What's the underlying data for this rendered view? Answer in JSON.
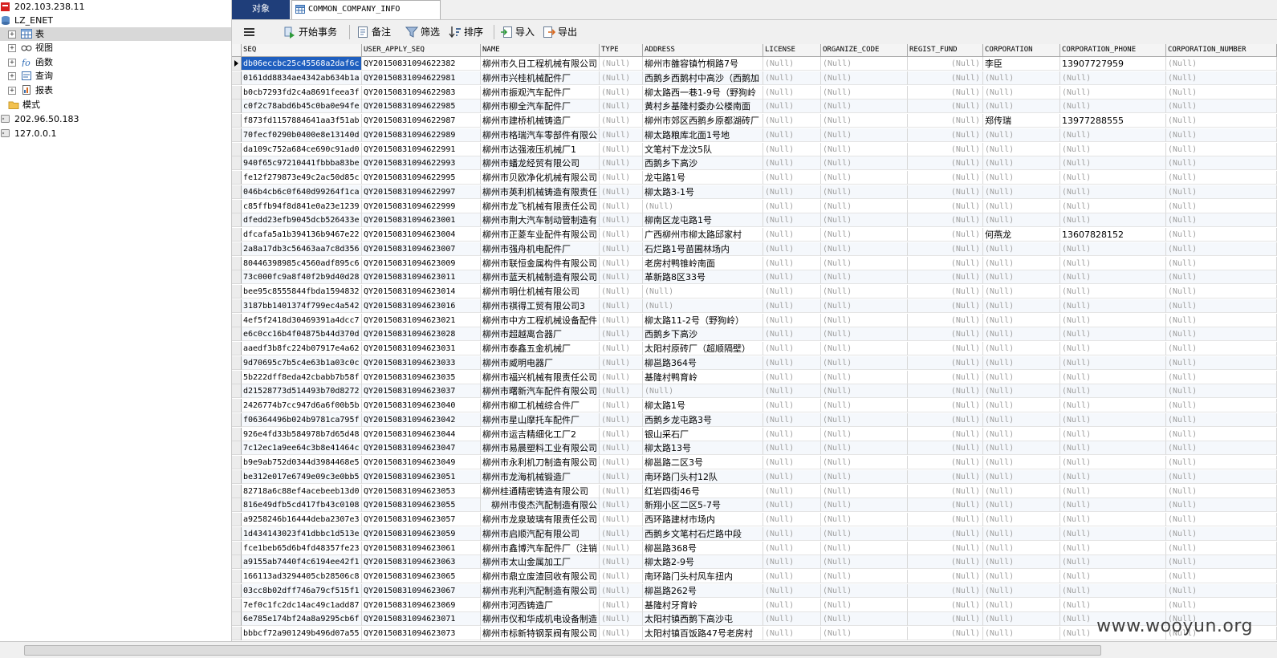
{
  "tree": {
    "nodes": [
      {
        "label": "202.103.238.11",
        "kind": "server-active"
      },
      {
        "label": "LZ_ENET",
        "kind": "database"
      },
      {
        "label": "表",
        "kind": "tables"
      },
      {
        "label": "视图",
        "kind": "views"
      },
      {
        "label": "函数",
        "kind": "functions"
      },
      {
        "label": "查询",
        "kind": "queries"
      },
      {
        "label": "报表",
        "kind": "reports"
      },
      {
        "label": "模式",
        "kind": "schemas"
      },
      {
        "label": "202.96.50.183",
        "kind": "server"
      },
      {
        "label": "127.0.0.1",
        "kind": "server"
      }
    ]
  },
  "tabs": {
    "objects": "对象",
    "table": "COMMON_COMPANY_INFO @LZ_E..."
  },
  "toolbar": {
    "menu_icon": "hamburger-icon",
    "begin_tx": "开始事务",
    "memo": "备注",
    "filter": "筛选",
    "sort": "排序",
    "import": "导入",
    "export": "导出"
  },
  "null_text": "(Null)",
  "columns": [
    "SEQ",
    "USER_APPLY_SEQ",
    "NAME",
    "TYPE",
    "ADDRESS",
    "LICENSE",
    "ORGANIZE_CODE",
    "REGIST_FUND",
    "CORPORATION",
    "CORPORATION_PHONE",
    "CORPORATION_NUMBER"
  ],
  "rows": [
    {
      "seq": "db06eccbc25c45568a2daf6c",
      "apply": "QY20150831094622382",
      "name": "柳州市久日工程机械有限公司",
      "address": "柳州市雒容镇竹桐路7号",
      "corp": "李臣",
      "phone": "13907727959"
    },
    {
      "seq": "0161dd8834ae4342ab634b1a",
      "apply": "QY20150831094622981",
      "name": "柳州市兴桂机械配件厂",
      "address": "西鹅乡西鹅村中高沙（西鹅加"
    },
    {
      "seq": "b0cb7293fd2c4a8691feea3f",
      "apply": "QY20150831094622983",
      "name": "柳州市振观汽车配件厂",
      "address": "柳太路西一巷1-9号（野狗岭"
    },
    {
      "seq": "c0f2c78abd6b45c0ba0e94fe",
      "apply": "QY20150831094622985",
      "name": "柳州市柳全汽车配件厂",
      "address": "黄村乡基隆村委办公楼南面"
    },
    {
      "seq": "f873fd1157884641aa3f51ab",
      "apply": "QY20150831094622987",
      "name": "柳州市建桥机械铸造厂",
      "address": "柳州市郊区西鹅乡原都湖砖厂",
      "corp": "郑传瑞",
      "phone": "13977288555"
    },
    {
      "seq": "70fecf0290b0400e8e13140d",
      "apply": "QY20150831094622989",
      "name": "柳州市格瑞汽车零部件有限公",
      "address": "柳太路粮库北面1号地"
    },
    {
      "seq": "da109c752a684ce690c91ad0",
      "apply": "QY20150831094622991",
      "name": "柳州市达强液压机械厂1",
      "address": "文笔村下龙汶5队"
    },
    {
      "seq": "940f65c97210441fbbba83be",
      "apply": "QY20150831094622993",
      "name": "柳州市蟠龙经贸有限公司",
      "address": "西鹅乡下高沙"
    },
    {
      "seq": "fe12f279873e49c2ac50d85c",
      "apply": "QY20150831094622995",
      "name": "柳州市贝欧净化机械有限公司",
      "address": "龙屯路1号"
    },
    {
      "seq": "046b4cb6c0f640d99264f1ca",
      "apply": "QY20150831094622997",
      "name": "柳州市英利机械铸造有限责任",
      "address": "柳太路3-1号"
    },
    {
      "seq": "c85ffb94f8d841e0a23e1239",
      "apply": "QY20150831094622999",
      "name": "柳州市龙飞机械有限责任公司",
      "address": ""
    },
    {
      "seq": "dfedd23efb9045dcb526433e",
      "apply": "QY20150831094623001",
      "name": "柳州市荆大汽车制动管制造有",
      "address": "柳南区龙屯路1号"
    },
    {
      "seq": "dfcafa5a1b394136b9467e22",
      "apply": "QY20150831094623004",
      "name": "柳州市正菱车业配件有限公司",
      "address": "广西柳州市柳太路邱家村",
      "corp": "何燕龙",
      "phone": "13607828152"
    },
    {
      "seq": "2a8a17db3c56463aa7c8d356",
      "apply": "QY20150831094623007",
      "name": "柳州市强舟机电配件厂",
      "address": "石烂路1号苗圃林场内"
    },
    {
      "seq": "80446398985c4560adf895c6",
      "apply": "QY20150831094623009",
      "name": "柳州市联恒金属构件有限公司",
      "address": "老房村鸭锥岭南面"
    },
    {
      "seq": "73c000fc9a8f40f2b9d40d28",
      "apply": "QY20150831094623011",
      "name": "柳州市蓝天机械制造有限公司",
      "address": "革新路8区33号"
    },
    {
      "seq": "bee95c8555844fbda1594832",
      "apply": "QY20150831094623014",
      "name": "柳州市明仕机械有限公司",
      "address": ""
    },
    {
      "seq": "3187bb1401374f799ec4a542",
      "apply": "QY20150831094623016",
      "name": "柳州市祺得工贸有限公司3",
      "address": ""
    },
    {
      "seq": "4ef5f2418d30469391a4dcc7",
      "apply": "QY20150831094623021",
      "name": "柳州市中方工程机械设备配件",
      "address": "柳太路11-2号（野狗岭）"
    },
    {
      "seq": "e6c0cc16b4f04875b44d370d",
      "apply": "QY20150831094623028",
      "name": "柳州市超越离合器厂",
      "address": "西鹅乡下高沙"
    },
    {
      "seq": "aaedf3b8fc224b07917e4a62",
      "apply": "QY20150831094623031",
      "name": "柳州市泰鑫五金机械厂",
      "address": "太阳村原砖厂（超顺隔壁）"
    },
    {
      "seq": "9d70695c7b5c4e63b1a03c0c",
      "apply": "QY20150831094623033",
      "name": "柳州市威明电器厂",
      "address": "柳邕路364号"
    },
    {
      "seq": "5b222dff8eda42cbabb7b58f",
      "apply": "QY20150831094623035",
      "name": "柳州市福兴机械有限责任公司",
      "address": "基隆村鸭育岭"
    },
    {
      "seq": "d21528773d514493b70d8272",
      "apply": "QY20150831094623037",
      "name": "柳州市曙新汽车配件有限公司",
      "address": ""
    },
    {
      "seq": "2426774b7cc947d6a6f00b5b",
      "apply": "QY20150831094623040",
      "name": "柳州市柳工机械综合件厂",
      "address": "柳太路1号"
    },
    {
      "seq": "f06364496b024b9781ca795f",
      "apply": "QY20150831094623042",
      "name": "柳州市星山摩托车配件厂",
      "address": "西鹅乡龙屯路3号"
    },
    {
      "seq": "926e4fd33b584978b7d65d48",
      "apply": "QY20150831094623044",
      "name": "柳州市运吉精细化工厂2",
      "address": "银山采石厂"
    },
    {
      "seq": "7c12ec1a9ee64c3b8e41464c",
      "apply": "QY20150831094623047",
      "name": "柳州市易晨塑料工业有限公司",
      "address": "柳太路13号"
    },
    {
      "seq": "b9e9ab752d0344d3984468e5",
      "apply": "QY20150831094623049",
      "name": "柳州市永利机刀制造有限公司",
      "address": "柳邕路二区3号"
    },
    {
      "seq": "be312e017e6749e09c3e0bb5",
      "apply": "QY20150831094623051",
      "name": "柳州市龙海机械锻造厂",
      "address": "南环路门头村12队"
    },
    {
      "seq": "82718a6c88ef4acebeeb13d0",
      "apply": "QY20150831094623053",
      "name": "柳州桂通精密铸造有限公司",
      "address": "红岩四街46号"
    },
    {
      "seq": "816e49dfb5cd417fb43c0108",
      "apply": "QY20150831094623055",
      "name": "　柳州市俊杰汽配制造有限公",
      "address": "新翔小区二区5-7号"
    },
    {
      "seq": "a9258246b16444deba2307e3",
      "apply": "QY20150831094623057",
      "name": "柳州市龙泉玻璃有限责任公司",
      "address": "西环路建材市场内"
    },
    {
      "seq": "1d434143023f41dbbc1d513e",
      "apply": "QY20150831094623059",
      "name": "柳州市启顺汽配有限公司",
      "address": "西鹅乡文笔村石烂路中段"
    },
    {
      "seq": "fce1beb65d6b4fd48357fe23",
      "apply": "QY20150831094623061",
      "name": "柳州市鑫博汽车配件厂（注销",
      "address": "柳邕路368号"
    },
    {
      "seq": "a9155ab7440f4c6194ee42f1",
      "apply": "QY20150831094623063",
      "name": "柳州市太山金属加工厂",
      "address": "柳太路2-9号"
    },
    {
      "seq": "166113ad3294405cb28506c8",
      "apply": "QY20150831094623065",
      "name": "柳州市鼎立废渣回收有限公司",
      "address": "南环路门头村风车扭内"
    },
    {
      "seq": "03cc8b02dff746a79cf515f1",
      "apply": "QY20150831094623067",
      "name": "柳州市兆利汽配制造有限公司",
      "address": "柳邕路262号"
    },
    {
      "seq": "7ef0c1fc2dc14ac49c1add87",
      "apply": "QY20150831094623069",
      "name": "柳州市河西铸造厂",
      "address": "基隆村牙育岭"
    },
    {
      "seq": "6e785e174bf24a8a9295cb6f",
      "apply": "QY20150831094623071",
      "name": "柳州市仪和华成机电设备制造",
      "address": "太阳村镇西鹅下高沙屯"
    },
    {
      "seq": "bbbcf72a901249b496d07a55",
      "apply": "QY20150831094623073",
      "name": "柳州市标新特钢泵阀有限公司",
      "address": "太阳村镇百饭路47号老房村"
    }
  ],
  "watermark": "www.wooyun.org"
}
